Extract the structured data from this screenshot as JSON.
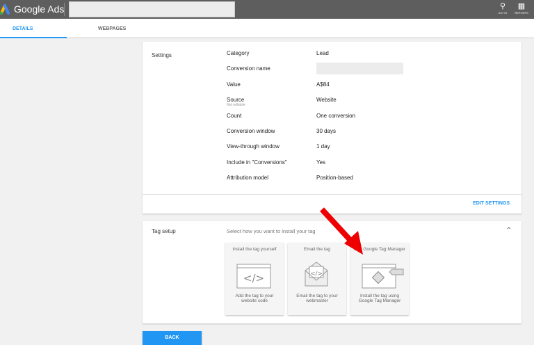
{
  "header": {
    "brand": "Google Ads",
    "search_value": "",
    "goto_label": "GO TO",
    "reports_label": "REPORTS"
  },
  "tabs": [
    {
      "label": "DETAILS",
      "active": true
    },
    {
      "label": "WEBPAGES",
      "active": false
    }
  ],
  "settings": {
    "title": "Settings",
    "rows": [
      {
        "label": "Category",
        "value": "Lead"
      },
      {
        "label": "Conversion name",
        "value": ""
      },
      {
        "label": "Value",
        "value": "A$84"
      },
      {
        "label": "Source",
        "sub": "Not editable",
        "value": "Website"
      },
      {
        "label": "Count",
        "value": "One conversion"
      },
      {
        "label": "Conversion window",
        "value": "30 days"
      },
      {
        "label": "View-through window",
        "value": "1 day"
      },
      {
        "label": "Include in \"Conversions\"",
        "value": "Yes"
      },
      {
        "label": "Attribution model",
        "value": "Position-based"
      }
    ],
    "edit_label": "EDIT SETTINGS"
  },
  "tag_setup": {
    "title": "Tag setup",
    "prompt": "Select how you want to install your tag",
    "options": [
      {
        "title": "Install the tag yourself",
        "desc": "Add the tag to your website code"
      },
      {
        "title": "Email the tag",
        "desc": "Email the tag to your webmaster"
      },
      {
        "title": "Use Google Tag Manager",
        "desc": "Install the tag using Google Tag Manager"
      }
    ]
  },
  "back_label": "BACK",
  "colors": {
    "accent": "#2196f3",
    "topbar": "#5e5e5e",
    "arrow": "#ee0000"
  }
}
